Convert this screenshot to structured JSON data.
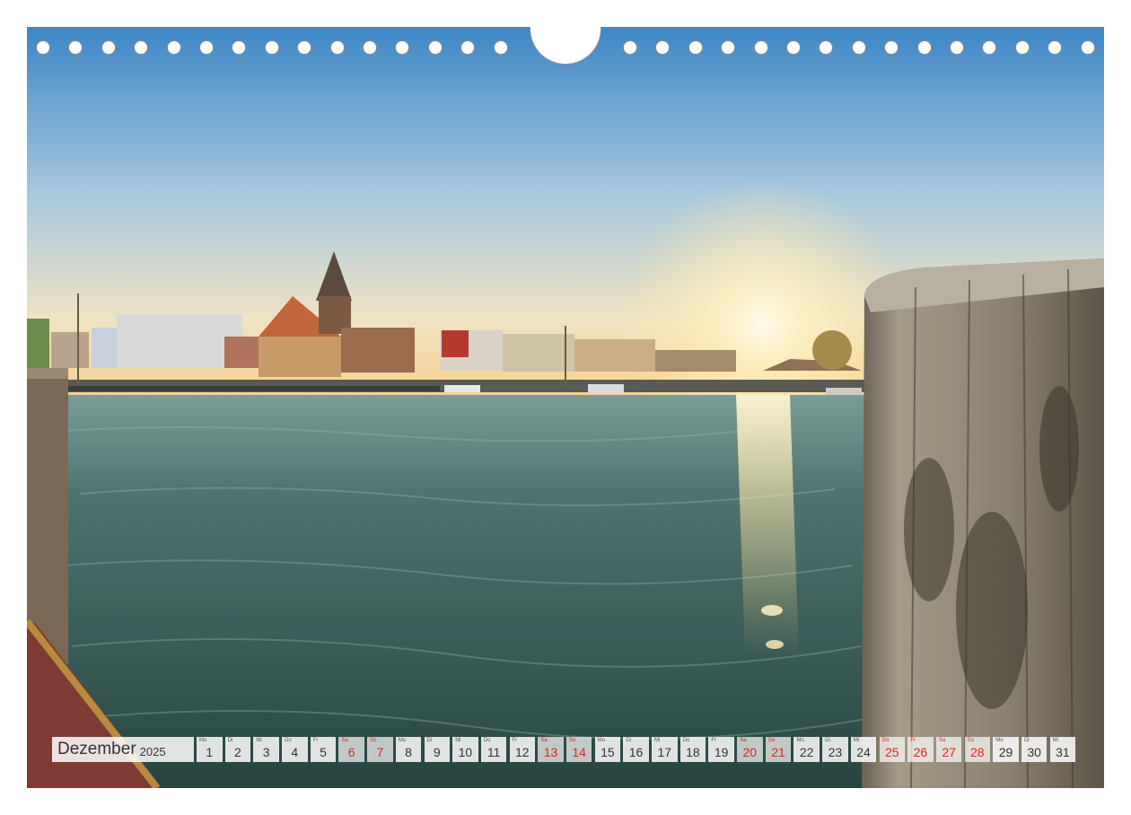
{
  "calendar": {
    "month": "Dezember",
    "year": "2025",
    "days": [
      {
        "wd": "Mo",
        "n": "1",
        "red": false
      },
      {
        "wd": "Di",
        "n": "2",
        "red": false
      },
      {
        "wd": "Mi",
        "n": "3",
        "red": false
      },
      {
        "wd": "Do",
        "n": "4",
        "red": false
      },
      {
        "wd": "Fr",
        "n": "5",
        "red": false
      },
      {
        "wd": "Sa",
        "n": "6",
        "red": true
      },
      {
        "wd": "So",
        "n": "7",
        "red": true
      },
      {
        "wd": "Mo",
        "n": "8",
        "red": false
      },
      {
        "wd": "Di",
        "n": "9",
        "red": false
      },
      {
        "wd": "Mi",
        "n": "10",
        "red": false
      },
      {
        "wd": "Do",
        "n": "11",
        "red": false
      },
      {
        "wd": "Fr",
        "n": "12",
        "red": false
      },
      {
        "wd": "Sa",
        "n": "13",
        "red": true
      },
      {
        "wd": "So",
        "n": "14",
        "red": true
      },
      {
        "wd": "Mo",
        "n": "15",
        "red": false
      },
      {
        "wd": "Di",
        "n": "16",
        "red": false
      },
      {
        "wd": "Mi",
        "n": "17",
        "red": false
      },
      {
        "wd": "Do",
        "n": "18",
        "red": false
      },
      {
        "wd": "Fr",
        "n": "19",
        "red": false
      },
      {
        "wd": "Sa",
        "n": "20",
        "red": true
      },
      {
        "wd": "So",
        "n": "21",
        "red": true
      },
      {
        "wd": "Mo",
        "n": "22",
        "red": false
      },
      {
        "wd": "Di",
        "n": "23",
        "red": false
      },
      {
        "wd": "Mi",
        "n": "24",
        "red": false
      },
      {
        "wd": "Do",
        "n": "25",
        "red": true
      },
      {
        "wd": "Fr",
        "n": "26",
        "red": true
      },
      {
        "wd": "Sa",
        "n": "27",
        "red": true
      },
      {
        "wd": "So",
        "n": "28",
        "red": true
      },
      {
        "wd": "Mo",
        "n": "29",
        "red": false
      },
      {
        "wd": "Di",
        "n": "30",
        "red": false
      },
      {
        "wd": "Mi",
        "n": "31",
        "red": false
      }
    ]
  },
  "colors": {
    "holiday_red": "#e0251b",
    "sky_top": "#4a8fc9",
    "sky_horizon": "#f3d9a4",
    "water": "#3b5f58"
  }
}
